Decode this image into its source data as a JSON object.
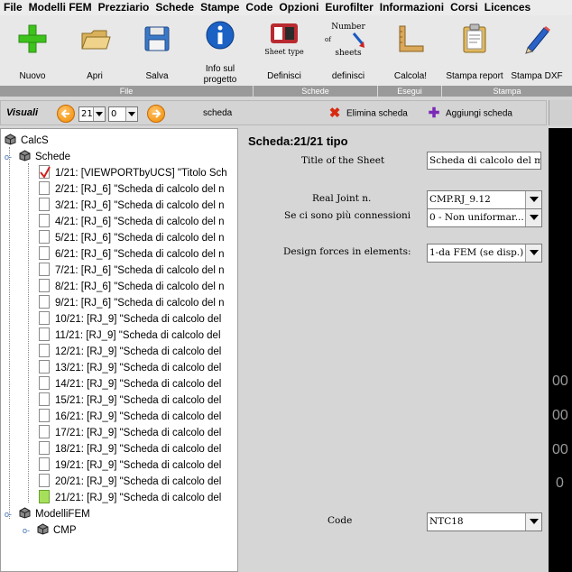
{
  "menu": [
    "File",
    "Modelli FEM",
    "Prezziario",
    "Schede",
    "Stampe",
    "Code",
    "Opzioni",
    "Eurofilter",
    "Informazioni",
    "Corsi",
    "Licences"
  ],
  "toolbar": {
    "buttons": [
      {
        "label": "Nuovo",
        "icon": "plus-icon"
      },
      {
        "label": "Apri",
        "icon": "folder-icon"
      },
      {
        "label": "Salva",
        "icon": "floppy-icon"
      },
      {
        "label": "Info sul progetto",
        "icon": "info-icon"
      },
      {
        "label": "Definisci",
        "icon": "sheet-type-icon",
        "icon_text": "Sheet type"
      },
      {
        "label": "definisci",
        "icon": "number-of-sheets-icon",
        "icon_text_1": "Number",
        "icon_text_2": "of",
        "icon_text_3": "sheets"
      },
      {
        "label": "Calcola!",
        "icon": "square-ruler-icon"
      },
      {
        "label": "Stampa report",
        "icon": "clipboard-icon"
      },
      {
        "label": "Stampa DXF",
        "icon": "pencil-icon"
      }
    ],
    "groups": [
      "File",
      "Schede",
      "Esegui",
      "Stampa"
    ]
  },
  "visuali": {
    "label": "Visuali",
    "spin1": "21",
    "spin2": "0",
    "scheda_label": "scheda",
    "delete_label": "Elimina scheda",
    "add_label": "Aggiungi scheda"
  },
  "tree": {
    "root": "CalcS",
    "schede": "Schede",
    "items": [
      "1/21: [VIEWPORTbyUCS] \"Titolo Sch",
      "2/21: [RJ_6] \"Scheda di calcolo del n",
      "3/21: [RJ_6] \"Scheda di calcolo del n",
      "4/21: [RJ_6] \"Scheda di calcolo del n",
      "5/21: [RJ_6] \"Scheda di calcolo del n",
      "6/21: [RJ_6] \"Scheda di calcolo del n",
      "7/21: [RJ_6] \"Scheda di calcolo del n",
      "8/21: [RJ_6] \"Scheda di calcolo del n",
      "9/21: [RJ_6] \"Scheda di calcolo del n",
      "10/21: [RJ_9] \"Scheda di calcolo del",
      "11/21: [RJ_9] \"Scheda di calcolo del",
      "12/21: [RJ_9] \"Scheda di calcolo del",
      "13/21: [RJ_9] \"Scheda di calcolo del",
      "14/21: [RJ_9] \"Scheda di calcolo del",
      "15/21: [RJ_9] \"Scheda di calcolo del",
      "16/21: [RJ_9] \"Scheda di calcolo del",
      "17/21: [RJ_9] \"Scheda di calcolo del",
      "18/21: [RJ_9] \"Scheda di calcolo del",
      "19/21: [RJ_9] \"Scheda di calcolo del",
      "20/21: [RJ_9] \"Scheda di calcolo del",
      "21/21: [RJ_9] \"Scheda di calcolo del"
    ],
    "modelli": "ModelliFEM",
    "cmp": "CMP"
  },
  "form": {
    "title": "Scheda:21/21 tipo",
    "title_of_sheet_label": "Title of the Sheet",
    "title_of_sheet_value": "Scheda di calcolo del m",
    "real_joint_label": "Real Joint n.",
    "real_joint_value": "CMP.RJ_9.12",
    "connessioni_label": "Se ci sono più connessioni",
    "connessioni_value": "0 - Non uniformar...",
    "design_forces_label": "Design forces in elements:",
    "design_forces_value": "1-da FEM (se disp.)",
    "code_label": "Code",
    "code_value": "NTC18"
  },
  "right_panel": [
    "00",
    "00",
    "00",
    "0"
  ]
}
